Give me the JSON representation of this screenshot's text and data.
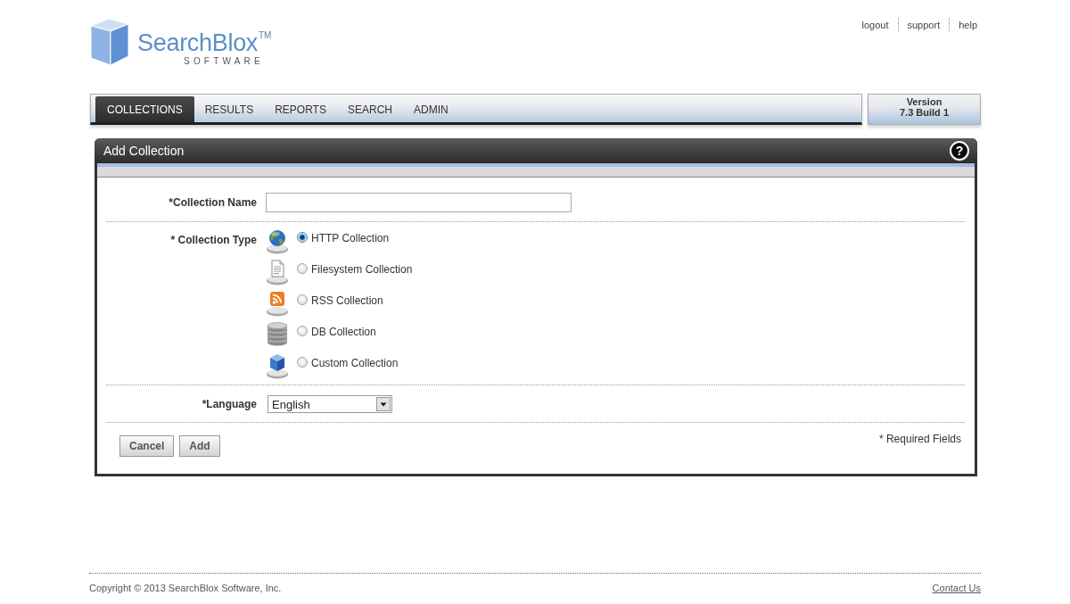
{
  "logo": {
    "name": "SearchBlox$^{TM}$",
    "tagline": "SOFTWARE"
  },
  "top_links": [
    "logout",
    "support",
    "help"
  ],
  "nav_tabs": [
    {
      "label": "COLLECTIONS",
      "selected": true
    },
    {
      "label": "RESULTS",
      "selected": false
    },
    {
      "label": "REPORTS",
      "selected": false
    },
    {
      "label": "SEARCH",
      "selected": false
    },
    {
      "label": "ADMIN",
      "selected": false
    }
  ],
  "version": {
    "label": "Version",
    "build": "7.3 Build 1"
  },
  "panel": {
    "title": "Add Collection",
    "help_button": "?"
  },
  "form": {
    "collection_name": {
      "label": "*Collection Name"
    },
    "collection_type": {
      "label": "* Collection Type",
      "options": [
        {
          "kind": "globe",
          "label": "HTTP Collection",
          "selected": true
        },
        {
          "kind": "document",
          "label": "Filesystem Collection",
          "selected": false
        },
        {
          "kind": "rss",
          "label": "RSS Collection",
          "selected": false
        },
        {
          "kind": "database",
          "label": "DB Collection",
          "selected": false
        },
        {
          "kind": "cube",
          "label": "Custom Collection",
          "selected": false
        }
      ]
    },
    "language": {
      "label": "*Language",
      "value": "English"
    },
    "buttons": {
      "cancel": "Cancel",
      "add": "Add"
    },
    "required_note": "* Required Fields"
  },
  "footer": {
    "copyright": "Copyright © 2013 SearchBlox Software, Inc.",
    "contact_link": "Contact Us"
  }
}
